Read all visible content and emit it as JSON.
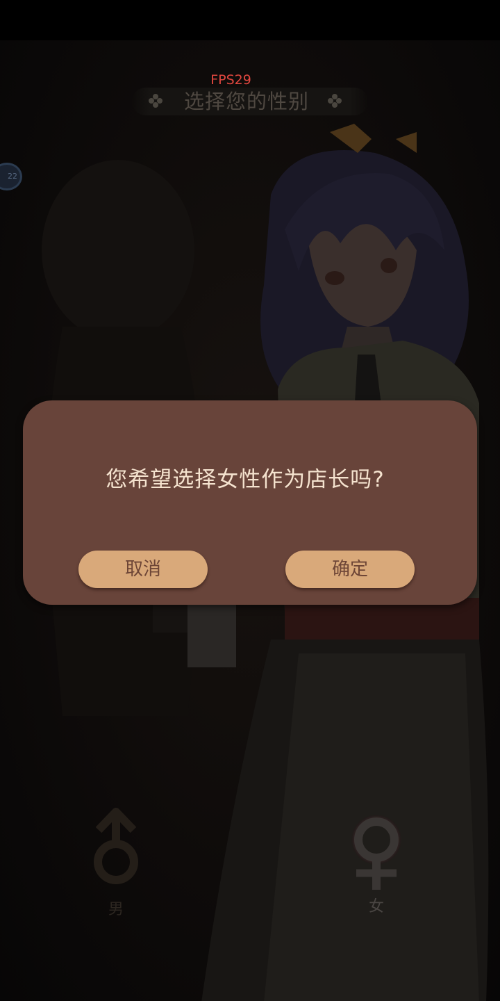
{
  "hud": {
    "fps_text": "FPS29",
    "side_badge_text": "22"
  },
  "header": {
    "title": "选择您的性别",
    "ornament_icon": "clover-icon"
  },
  "gender_options": {
    "male": {
      "label": "男",
      "icon": "male-symbol-icon"
    },
    "female": {
      "label": "女",
      "icon": "female-symbol-icon",
      "selected": true
    }
  },
  "dialog": {
    "message": "您希望选择女性作为店长吗?",
    "cancel_label": "取消",
    "confirm_label": "确定"
  },
  "colors": {
    "dialog_bg": "#68443a",
    "button_bg": "#d9a97a",
    "fps_red": "#e0473f"
  }
}
